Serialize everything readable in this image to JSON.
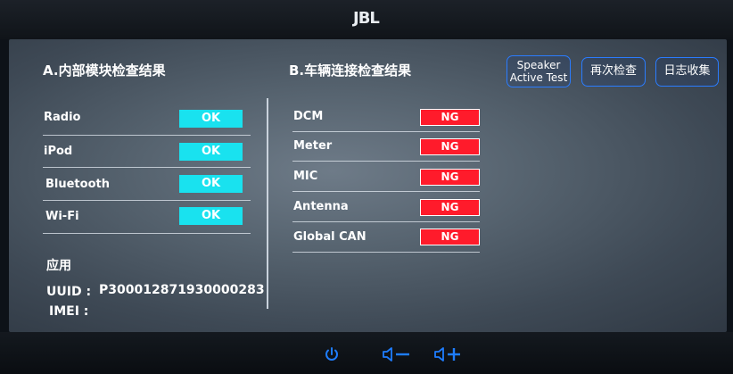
{
  "brand": "JBL",
  "left_panel": {
    "title": "A.内部模块检查结果",
    "rows": [
      {
        "label": "Radio",
        "status": "OK"
      },
      {
        "label": "iPod",
        "status": "OK"
      },
      {
        "label": "Bluetooth",
        "status": "OK"
      },
      {
        "label": "Wi-Fi",
        "status": "OK"
      }
    ],
    "app_label": "应用",
    "uuid_label": "UUID :",
    "uuid_value": "P300012871930000283",
    "imei_label": "IMEI :"
  },
  "right_panel": {
    "title": "B.车辆连接检查结果",
    "rows": [
      {
        "label": "DCM",
        "status": "NG"
      },
      {
        "label": "Meter",
        "status": "NG"
      },
      {
        "label": "MIC",
        "status": "NG"
      },
      {
        "label": "Antenna",
        "status": "NG"
      },
      {
        "label": "Global CAN",
        "status": "NG"
      }
    ]
  },
  "buttons": {
    "speaker_line1": "Speaker",
    "speaker_line2": "Active Test",
    "recheck": "再次检查",
    "log_collect": "日志收集"
  },
  "controls": [
    "power-icon",
    "volume-down-icon",
    "volume-up-icon"
  ],
  "colors": {
    "ok": "#19e2ef",
    "ng": "#ff1b2b",
    "button_border": "#2a7cff",
    "control": "#1e7dff"
  }
}
